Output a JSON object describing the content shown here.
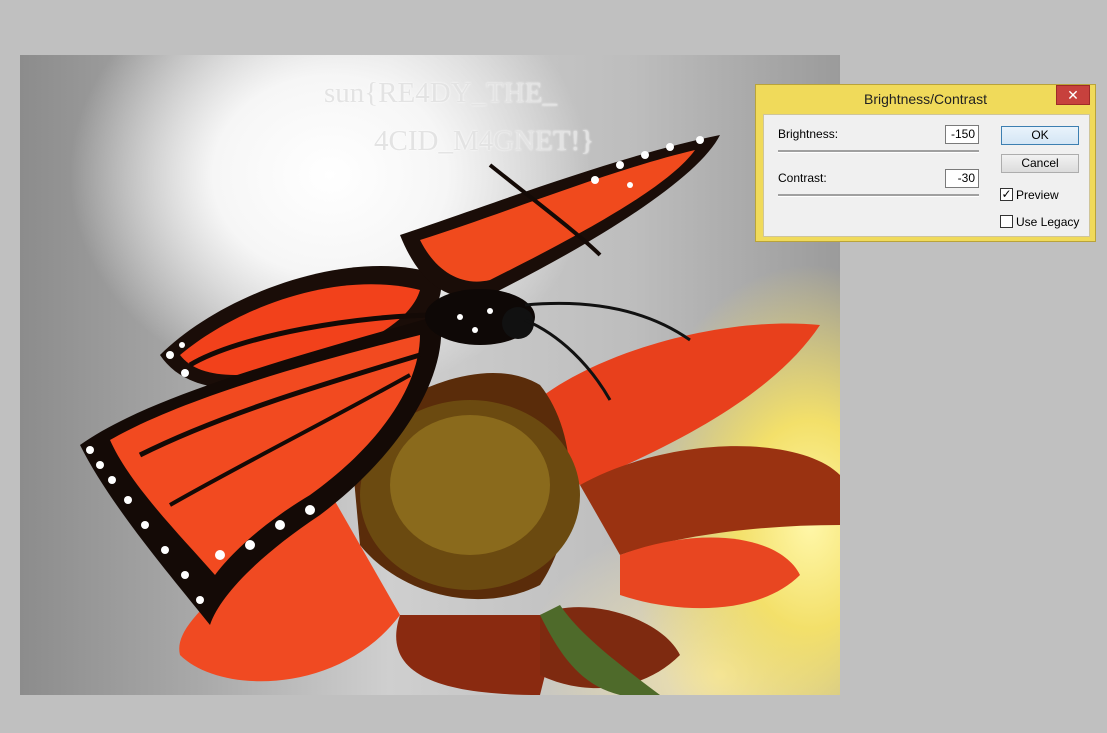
{
  "canvas": {
    "flag_line_1": "sun{RE4DY_THE_",
    "flag_line_2": "4CID_M4GNET!}"
  },
  "dialog": {
    "title": "Brightness/Contrast",
    "close_glyph": "✕",
    "brightness": {
      "label": "Brightness:",
      "value": "-150"
    },
    "contrast": {
      "label": "Contrast:",
      "value": "-30"
    },
    "ok_label": "OK",
    "cancel_label": "Cancel",
    "preview": {
      "label": "Preview",
      "checked": true,
      "check_glyph": "✓"
    },
    "use_legacy": {
      "label": "Use Legacy",
      "checked": false
    }
  },
  "colors": {
    "dialog_frame": "#f0da5a",
    "close_button": "#c7413d",
    "workspace": "#c0c0c0"
  }
}
